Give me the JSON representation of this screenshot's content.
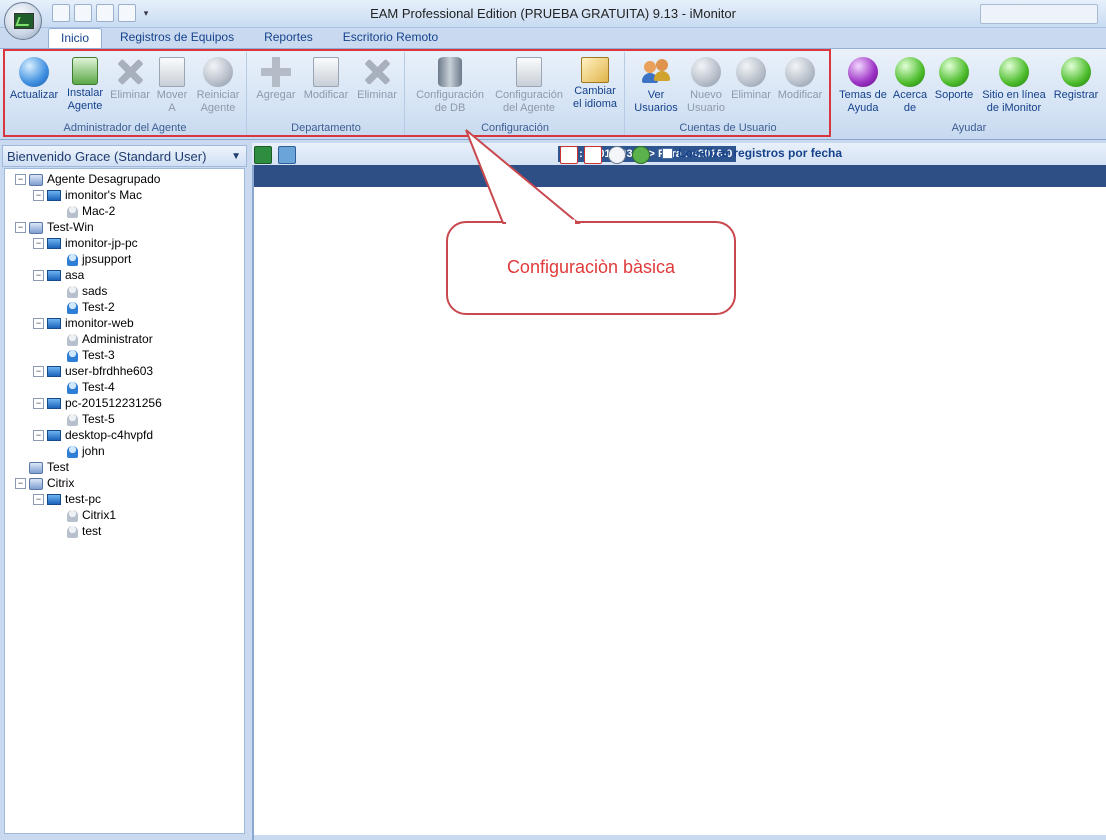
{
  "window": {
    "title": "EAM Professional Edition (PRUEBA GRATUITA) 9.13 - iMonitor"
  },
  "tabs": [
    {
      "label": "Inicio",
      "active": true
    },
    {
      "label": "Registros de Equipos",
      "active": false
    },
    {
      "label": "Reportes",
      "active": false
    },
    {
      "label": "Escritorio Remoto",
      "active": false
    }
  ],
  "ribbon": {
    "groups": [
      {
        "label": "Administrador del Agente"
      },
      {
        "label": "Departamento"
      },
      {
        "label": "Configuración"
      },
      {
        "label": "Cuentas de Usuario"
      },
      {
        "label": "Ayudar"
      }
    ],
    "buttons": [
      {
        "label": "Actualizar",
        "icon": "refresh-icon",
        "enabled": true
      },
      {
        "label": "Instalar\nAgente",
        "icon": "install-agent-icon",
        "enabled": true
      },
      {
        "label": "Eliminar",
        "icon": "delete-icon",
        "enabled": false
      },
      {
        "label": "Mover\nA",
        "icon": "move-icon",
        "enabled": false
      },
      {
        "label": "Reiniciar\nAgente",
        "icon": "restart-icon",
        "enabled": false
      },
      {
        "label": "Agregar",
        "icon": "add-icon",
        "enabled": false
      },
      {
        "label": "Modificar",
        "icon": "edit-icon",
        "enabled": false
      },
      {
        "label": "Eliminar",
        "icon": "delete-icon",
        "enabled": false
      },
      {
        "label": "Configuración\nde DB",
        "icon": "database-icon",
        "enabled": false
      },
      {
        "label": "Configuración\ndel Agente",
        "icon": "agent-settings-icon",
        "enabled": false
      },
      {
        "label": "Cambiar\nel idioma",
        "icon": "language-icon",
        "enabled": true
      },
      {
        "label": "Ver\nUsuarios",
        "icon": "users-icon",
        "enabled": true
      },
      {
        "label": "Nuevo\nUsuario",
        "icon": "new-user-icon",
        "enabled": false
      },
      {
        "label": "Eliminar",
        "icon": "delete-user-icon",
        "enabled": false
      },
      {
        "label": "Modificar",
        "icon": "edit-user-icon",
        "enabled": false
      },
      {
        "label": "Temas de\nAyuda",
        "icon": "help-topics-icon",
        "enabled": true
      },
      {
        "label": "Acerca\nde",
        "icon": "about-icon",
        "enabled": true
      },
      {
        "label": "Soporte",
        "icon": "support-icon",
        "enabled": true
      },
      {
        "label": "Sitio en línea\nde iMonitor",
        "icon": "home-icon",
        "enabled": true
      },
      {
        "label": "Registrar",
        "icon": "cart-icon",
        "enabled": true
      }
    ]
  },
  "left_panel": {
    "header": "Bienvenido Grace (Standard User)",
    "tree": [
      {
        "label": "Agente Desagrupado",
        "level": 0,
        "type": "group",
        "expand": "−"
      },
      {
        "label": "imonitor's Mac",
        "level": 1,
        "type": "pc",
        "expand": "−"
      },
      {
        "label": "Mac-2",
        "level": 2,
        "type": "user-off",
        "expand": ""
      },
      {
        "label": "Test-Win",
        "level": 0,
        "type": "group",
        "expand": "−"
      },
      {
        "label": "imonitor-jp-pc",
        "level": 1,
        "type": "pc",
        "expand": "−"
      },
      {
        "label": "jpsupport",
        "level": 2,
        "type": "user-on",
        "expand": ""
      },
      {
        "label": "asa",
        "level": 1,
        "type": "pc",
        "expand": "−"
      },
      {
        "label": "sads",
        "level": 2,
        "type": "user-off",
        "expand": ""
      },
      {
        "label": "Test-2",
        "level": 2,
        "type": "user-on",
        "expand": ""
      },
      {
        "label": "imonitor-web",
        "level": 1,
        "type": "pc",
        "expand": "−"
      },
      {
        "label": "Administrator",
        "level": 2,
        "type": "user-off",
        "expand": ""
      },
      {
        "label": "Test-3",
        "level": 2,
        "type": "user-on",
        "expand": ""
      },
      {
        "label": "user-bfrdhhe603",
        "level": 1,
        "type": "pc",
        "expand": "−"
      },
      {
        "label": "Test-4",
        "level": 2,
        "type": "user-on",
        "expand": ""
      },
      {
        "label": "pc-201512231256",
        "level": 1,
        "type": "pc",
        "expand": "−"
      },
      {
        "label": "Test-5",
        "level": 2,
        "type": "user-off",
        "expand": ""
      },
      {
        "label": "desktop-c4hvpfd",
        "level": 1,
        "type": "pc",
        "expand": "−"
      },
      {
        "label": "john",
        "level": 2,
        "type": "user-on",
        "expand": ""
      },
      {
        "label": "Test",
        "level": 0,
        "type": "group",
        "expand": ""
      },
      {
        "label": "Citrix",
        "level": 0,
        "type": "group",
        "expand": "−"
      },
      {
        "label": "test-pc",
        "level": 1,
        "type": "pc",
        "expand": "−"
      },
      {
        "label": "Citrix1",
        "level": 2,
        "type": "user-off",
        "expand": ""
      },
      {
        "label": "test",
        "level": 2,
        "type": "user-off",
        "expand": ""
      }
    ]
  },
  "records_toolbar": {
    "date_range": "De : <2016-03-29> Para : <2016-0",
    "locate_by_date_label": "Localizar registros por fecha",
    "locate_by_date_checked": false
  },
  "callout": {
    "text": "Configuraciòn bàsica"
  },
  "colors": {
    "highlight": "#d9373f",
    "callout_text": "#e03a3a",
    "accent": "#15428b"
  }
}
